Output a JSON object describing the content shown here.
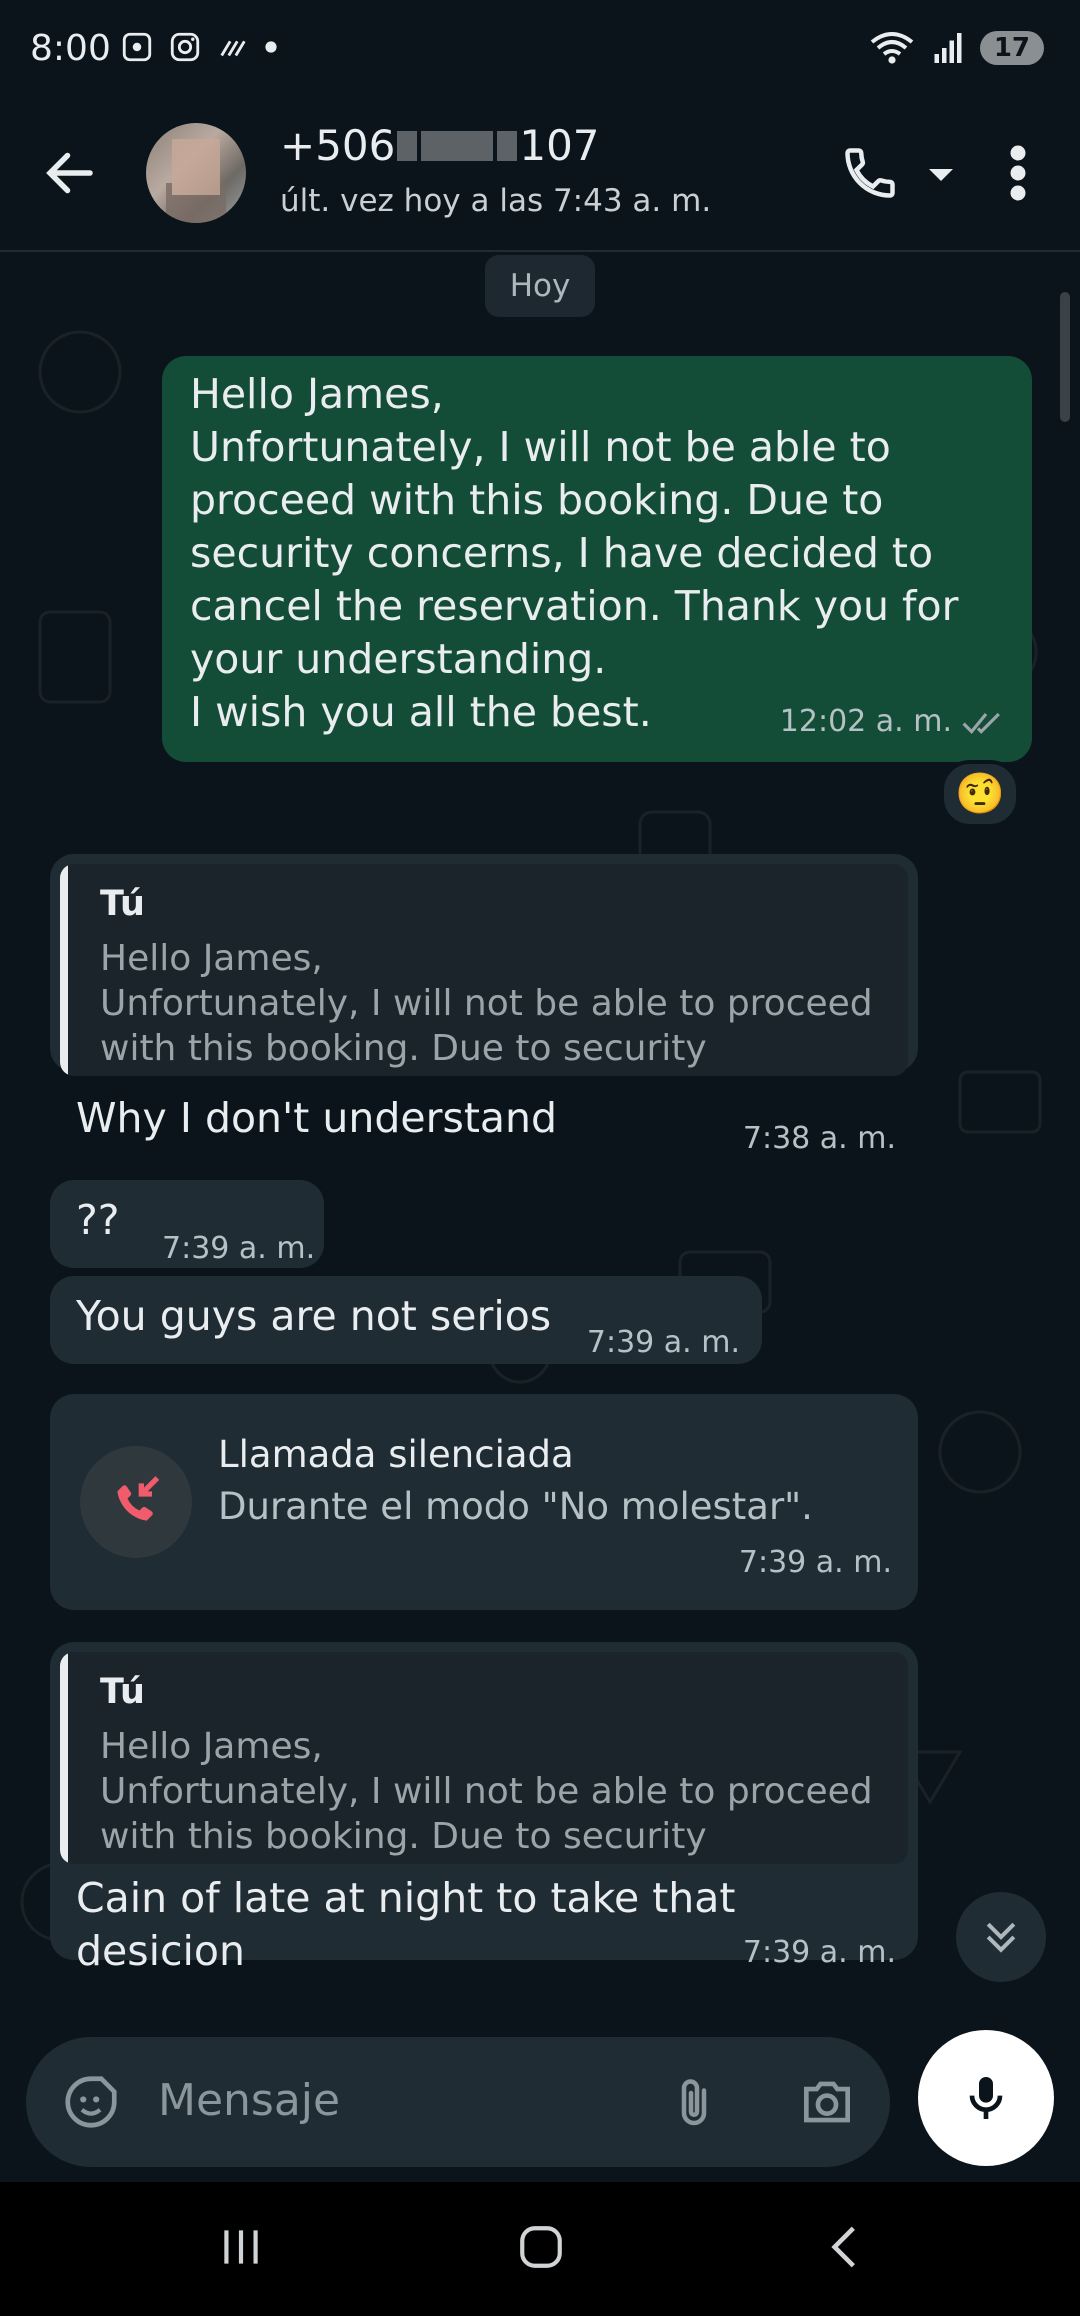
{
  "status_bar": {
    "time": "8:00",
    "battery": "17"
  },
  "header": {
    "name_prefix": "+506",
    "name_suffix": "107",
    "last_seen": "últ. vez hoy a las 7:43 a. m."
  },
  "chat": {
    "date_chip": "Hoy",
    "messages": [
      {
        "text": "Hello James,\nUnfortunately, I will not be able to proceed with this booking. Due to security concerns, I have decided to cancel the reservation. Thank you for your understanding.\nI wish you all the best.",
        "time": "12:02 a. m.",
        "reaction": "🤨"
      },
      {
        "quote_author": "Tú",
        "quote_text": "Hello James,\nUnfortunately, I will not be able to proceed\nwith this booking. Due to security concern...",
        "text": "Why I don't understand",
        "time": "7:38 a. m."
      },
      {
        "text": "??",
        "time": "7:39 a. m."
      },
      {
        "text": "You guys are not serios",
        "time": "7:39 a. m."
      },
      {
        "call_title": "Llamada silenciada",
        "call_subtitle": "Durante el modo \"No molestar\".",
        "time": "7:39 a. m."
      },
      {
        "quote_author": "Tú",
        "quote_text": "Hello James,\nUnfortunately, I will not be able to proceed\nwith this booking. Due to security concern...",
        "text": "Cain of late at night to take that\ndesicion",
        "time": "7:39 a. m."
      }
    ]
  },
  "input": {
    "placeholder": "Mensaje"
  }
}
